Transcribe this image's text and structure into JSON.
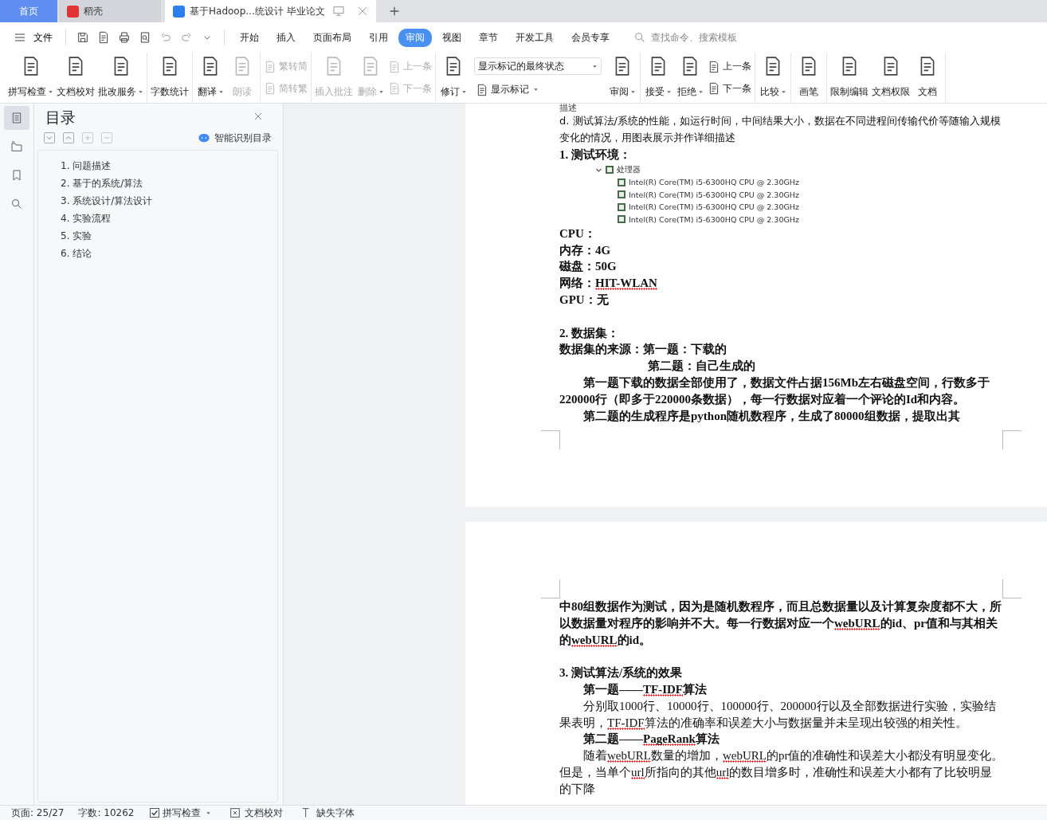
{
  "tabs": [
    {
      "kind": "home",
      "label": "首页",
      "selected": false
    },
    {
      "kind": "app",
      "label": "稻壳",
      "selected": false
    },
    {
      "kind": "doc",
      "label": "基于Hadoop...统设计 毕业论文",
      "selected": true
    }
  ],
  "menu": {
    "file": "文件",
    "tabs": [
      {
        "label": "开始",
        "selected": false
      },
      {
        "label": "插入",
        "selected": false
      },
      {
        "label": "页面布局",
        "selected": false
      },
      {
        "label": "引用",
        "selected": false
      },
      {
        "label": "审阅",
        "selected": true
      },
      {
        "label": "视图",
        "selected": false
      },
      {
        "label": "章节",
        "selected": false
      },
      {
        "label": "开发工具",
        "selected": false
      },
      {
        "label": "会员专享",
        "selected": false
      }
    ],
    "search_placeholder": "查找命令、搜索模板"
  },
  "ribbon": [
    {
      "items": [
        {
          "kind": "large",
          "label": "拼写检查",
          "dropdown": true,
          "disabled": false
        },
        {
          "kind": "large",
          "label": "文档校对",
          "dropdown": false,
          "disabled": false
        },
        {
          "kind": "large",
          "label": "批改服务",
          "dropdown": true,
          "disabled": false
        }
      ]
    },
    {
      "items": [
        {
          "kind": "large",
          "label": "字数统计",
          "dropdown": false,
          "disabled": false
        }
      ]
    },
    {
      "items": [
        {
          "kind": "large",
          "label": "翻译",
          "dropdown": true,
          "disabled": false
        },
        {
          "kind": "large",
          "label": "朗读",
          "dropdown": false,
          "disabled": true
        }
      ]
    },
    {
      "items": [
        {
          "kind": "stack",
          "children": [
            {
              "label": "繁转简",
              "disabled": true
            },
            {
              "label": "简转繁",
              "disabled": true
            }
          ]
        }
      ]
    },
    {
      "items": [
        {
          "kind": "large",
          "label": "插入批注",
          "dropdown": false,
          "disabled": true
        },
        {
          "kind": "large",
          "label": "删除",
          "dropdown": true,
          "disabled": true
        },
        {
          "kind": "stack",
          "children": [
            {
              "label": "上一条",
              "disabled": true
            },
            {
              "label": "下一条",
              "disabled": true
            }
          ]
        }
      ]
    },
    {
      "items": [
        {
          "kind": "large",
          "label": "修订",
          "dropdown": true,
          "disabled": false
        },
        {
          "kind": "select",
          "value": "显示标记的最终状态",
          "label": "显示标记"
        },
        {
          "kind": "large",
          "label": "审阅",
          "dropdown": true,
          "disabled": false
        }
      ]
    },
    {
      "items": [
        {
          "kind": "large",
          "label": "接受",
          "dropdown": true,
          "disabled": false
        },
        {
          "kind": "large",
          "label": "拒绝",
          "dropdown": true,
          "disabled": false
        },
        {
          "kind": "stack",
          "children": [
            {
              "label": "上一条",
              "disabled": false
            },
            {
              "label": "下一条",
              "disabled": false
            }
          ]
        }
      ]
    },
    {
      "items": [
        {
          "kind": "large",
          "label": "比较",
          "dropdown": true,
          "disabled": false
        }
      ]
    },
    {
      "items": [
        {
          "kind": "large",
          "label": "画笔",
          "dropdown": false,
          "disabled": false
        }
      ]
    },
    {
      "items": [
        {
          "kind": "large",
          "label": "限制编辑",
          "dropdown": false,
          "disabled": false
        },
        {
          "kind": "large",
          "label": "文档权限",
          "dropdown": false,
          "disabled": false
        },
        {
          "kind": "large",
          "label": "文档",
          "dropdown": false,
          "disabled": false
        }
      ]
    }
  ],
  "side_strip": [
    {
      "selected": true
    },
    {
      "selected": false
    },
    {
      "selected": false
    },
    {
      "selected": false
    }
  ],
  "toc": {
    "title": "目录",
    "smart": "智能识别目录",
    "items": [
      "1. 问题描述",
      "2. 基于的系统/算法",
      "3. 系统设计/算法设计",
      "4. 实验流程",
      "5. 实验",
      "6. 结论"
    ]
  },
  "pages": [
    {
      "blocks": [
        {
          "kind": "plain",
          "indent": false,
          "deep_indent": false,
          "text": "描述"
        },
        {
          "kind": "plain",
          "indent": false,
          "deep_indent": false,
          "text": "d. 测试算法/系统的性能，如运行时间，中间结果大小，数据在不同进程间传输代价等随输入规模变化的情况，用图表展示并作详细描述"
        },
        {
          "kind": "heading",
          "indent": false,
          "deep_indent": false,
          "text": "1. 测试环境："
        },
        {
          "kind": "image",
          "root": "处理器",
          "expanded": true,
          "children": [
            "Intel(R) Core(TM) i5-6300HQ CPU @ 2.30GHz",
            "Intel(R) Core(TM) i5-6300HQ CPU @ 2.30GHz",
            "Intel(R) Core(TM) i5-6300HQ CPU @ 2.30GHz",
            "Intel(R) Core(TM) i5-6300HQ CPU @ 2.30GHz"
          ]
        },
        {
          "kind": "body",
          "indent": false,
          "deep_indent": false,
          "text": "CPU："
        },
        {
          "kind": "body",
          "indent": false,
          "deep_indent": false,
          "text": "内存：4G"
        },
        {
          "kind": "body",
          "indent": false,
          "deep_indent": false,
          "text": "磁盘：50G"
        },
        {
          "kind": "body",
          "indent": false,
          "deep_indent": false,
          "runs": [
            {
              "text": "网络：",
              "misspelled": false
            },
            {
              "text": "HIT-WLAN",
              "misspelled": true
            }
          ]
        },
        {
          "kind": "body",
          "indent": false,
          "deep_indent": false,
          "text": "GPU：无"
        },
        {
          "kind": "blank"
        },
        {
          "kind": "heading",
          "indent": false,
          "deep_indent": false,
          "text": "2. 数据集："
        },
        {
          "kind": "body",
          "indent": false,
          "deep_indent": false,
          "text": "数据集的来源：第一题：下载的"
        },
        {
          "kind": "body",
          "indent": false,
          "deep_indent": true,
          "text": "第二题：自己生成的"
        },
        {
          "kind": "body",
          "indent": true,
          "deep_indent": false,
          "text": "第一题下载的数据全部使用了，数据文件占据156Mb左右磁盘空间，行数多于220000行（即多于220000条数据），每一行数据对应着一个评论的Id和内容。"
        },
        {
          "kind": "body",
          "indent": true,
          "deep_indent": false,
          "text": "第二题的生成程序是python随机数程序，生成了80000组数据，提取出其"
        }
      ]
    },
    {
      "blocks": [
        {
          "kind": "body",
          "indent": false,
          "deep_indent": false,
          "runs": [
            {
              "text": "中80组数据作为测试，因为是随机数程序，而且总数据量以及计算复杂度都不大，所以数据量对程序的影响并不大。每一行数据对应一个",
              "misspelled": false
            },
            {
              "text": "webURL",
              "misspelled": true
            },
            {
              "text": "的id、pr值和与其相关的",
              "misspelled": false
            },
            {
              "text": "webURL",
              "misspelled": true
            },
            {
              "text": "的id。",
              "misspelled": false
            }
          ]
        },
        {
          "kind": "blank"
        },
        {
          "kind": "heading",
          "indent": false,
          "deep_indent": false,
          "text": "3. 测试算法/系统的效果"
        },
        {
          "kind": "body",
          "indent": true,
          "deep_indent": false,
          "runs": [
            {
              "text": "第一题——",
              "misspelled": false
            },
            {
              "text": "TF-IDF",
              "misspelled": true
            },
            {
              "text": "算法",
              "misspelled": false
            }
          ]
        },
        {
          "kind": "text",
          "indent": true,
          "deep_indent": false,
          "runs": [
            {
              "text": "分别取1000行、10000行、100000行、200000行以及全部数据进行实验，实验结果表明，",
              "misspelled": false
            },
            {
              "text": "TF-IDF",
              "misspelled": true
            },
            {
              "text": "算法的准确率和误差大小与数据量并未呈现出较强的相关性。",
              "misspelled": false
            }
          ]
        },
        {
          "kind": "body",
          "indent": true,
          "deep_indent": false,
          "runs": [
            {
              "text": "第二题——",
              "misspelled": false
            },
            {
              "text": "PageRank",
              "misspelled": true
            },
            {
              "text": "算法",
              "misspelled": false
            }
          ]
        },
        {
          "kind": "text",
          "indent": true,
          "deep_indent": false,
          "runs": [
            {
              "text": "随着",
              "misspelled": false
            },
            {
              "text": "webURL",
              "misspelled": true
            },
            {
              "text": "数量的增加，",
              "misspelled": false
            },
            {
              "text": "webURL",
              "misspelled": true
            },
            {
              "text": "的pr值的准确性和误差大小都没有明显变化。但是，当单个",
              "misspelled": false
            },
            {
              "text": "url",
              "misspelled": true
            },
            {
              "text": "所指向的其他",
              "misspelled": false
            },
            {
              "text": "url",
              "misspelled": true
            },
            {
              "text": "的数目增多时，准确性和误差大小都有了比较明显的下降",
              "misspelled": false
            }
          ]
        }
      ]
    }
  ],
  "status": {
    "page": "页面: 25/27",
    "words": "字数: 10262",
    "spell": {
      "label": "拼写检查",
      "checked": true
    },
    "proof": "文档校对",
    "font": "缺失字体"
  }
}
